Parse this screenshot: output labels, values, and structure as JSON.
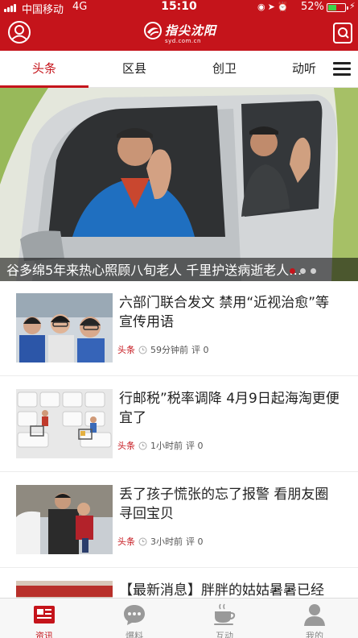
{
  "status_bar": {
    "carrier": "中国移动",
    "network": "4G",
    "time": "15:10",
    "battery": "52%",
    "battery_level": 0.52
  },
  "header": {
    "logo_name": "指尖沈阳",
    "logo_url": "syd.com.cn",
    "icons": [
      "user-icon",
      "scan-icon"
    ]
  },
  "tabs": [
    {
      "label": "头条",
      "active": true
    },
    {
      "label": "区县",
      "active": false
    },
    {
      "label": "创卫",
      "active": false
    },
    {
      "label": "动听",
      "active": false
    }
  ],
  "banner": {
    "caption": "谷多绵5年来热心照顾八旬老人  千里护送病逝老人…"
  },
  "news": [
    {
      "title": "六部门联合发文  禁用“近视治愈”等宣传用语",
      "tag": "头条",
      "time": "59分钟前",
      "comments": "评 0"
    },
    {
      "title": "行邮税”税率调降  4月9日起海淘更便宜了",
      "tag": "头条",
      "time": "1小时前",
      "comments": "评 0"
    },
    {
      "title": "丢了孩子慌张的忘了报警 看朋友圈寻回宝贝",
      "tag": "头条",
      "time": "3小时前",
      "comments": "评 0"
    },
    {
      "title": "【最新消息】胖胖的姑姑暑暑已经",
      "tag": "",
      "time": "",
      "comments": ""
    }
  ],
  "bottom_nav": [
    {
      "label": "资讯",
      "icon": "news-icon",
      "active": true
    },
    {
      "label": "爆料",
      "icon": "chat-icon",
      "active": false
    },
    {
      "label": "互动",
      "icon": "coffee-icon",
      "active": false
    },
    {
      "label": "我的",
      "icon": "person-icon",
      "active": false
    }
  ],
  "colors": {
    "brand_red": "#c5141b"
  }
}
